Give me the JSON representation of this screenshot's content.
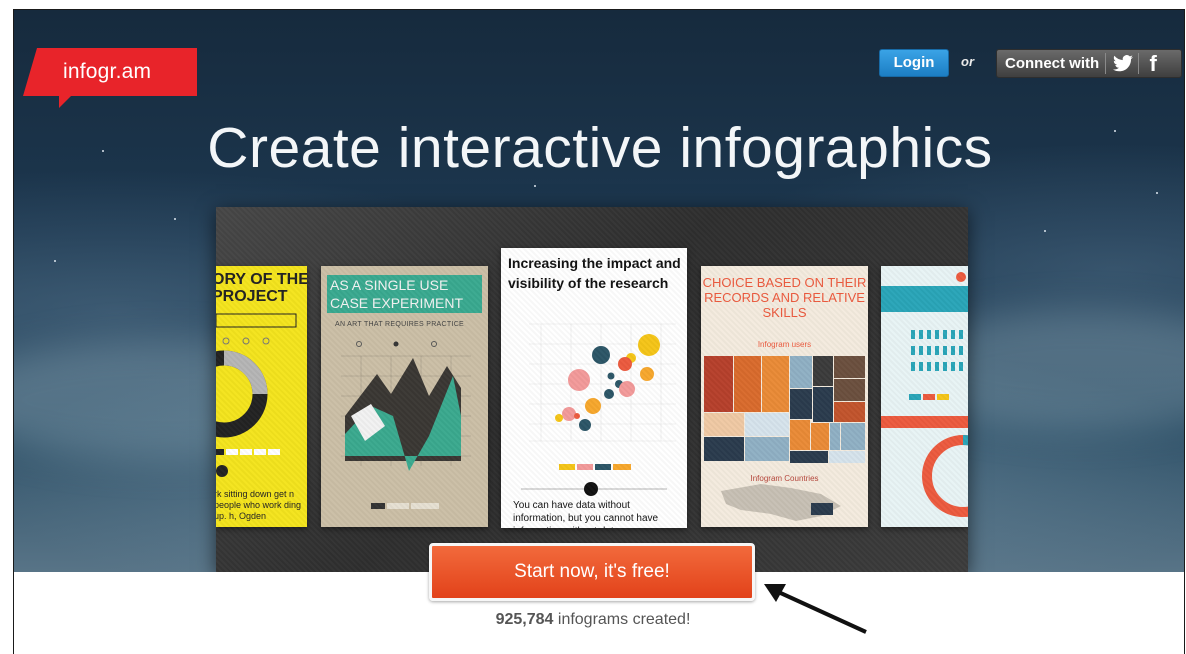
{
  "header": {
    "logo_text": "infogr.am",
    "login_label": "Login",
    "or_label": "or",
    "connect_label": "Connect with",
    "social_icons": [
      "twitter-icon",
      "facebook-icon"
    ]
  },
  "hero": {
    "headline": "Create interactive infographics"
  },
  "gallery": {
    "cards": [
      {
        "title": "ORY OF THE PROJECT",
        "footer": "rk sitting down get n people who work ding up. h, Ogden"
      },
      {
        "title": "AS A SINGLE USE CASE EXPERIMENT",
        "subtitle": "AN ART THAT REQUIRES PRACTICE"
      },
      {
        "title": "Increasing the impact and visibility of the research",
        "quote": "You can have data without information, but you cannot have information without data."
      },
      {
        "title": "CHOICE BASED ON THEIR RECORDS AND RELATIVE SKILLS",
        "subtitle": "Infogram users",
        "subtitle2": "Infogram Countries"
      },
      {
        "title": ""
      }
    ]
  },
  "cta": {
    "label": "Start now, it's free!",
    "count": "925,784",
    "count_suffix": " infograms created!"
  },
  "colors": {
    "brand_red": "#e8242a",
    "login_blue": "#2a8fd6",
    "cta_orange": "#e8471d"
  }
}
